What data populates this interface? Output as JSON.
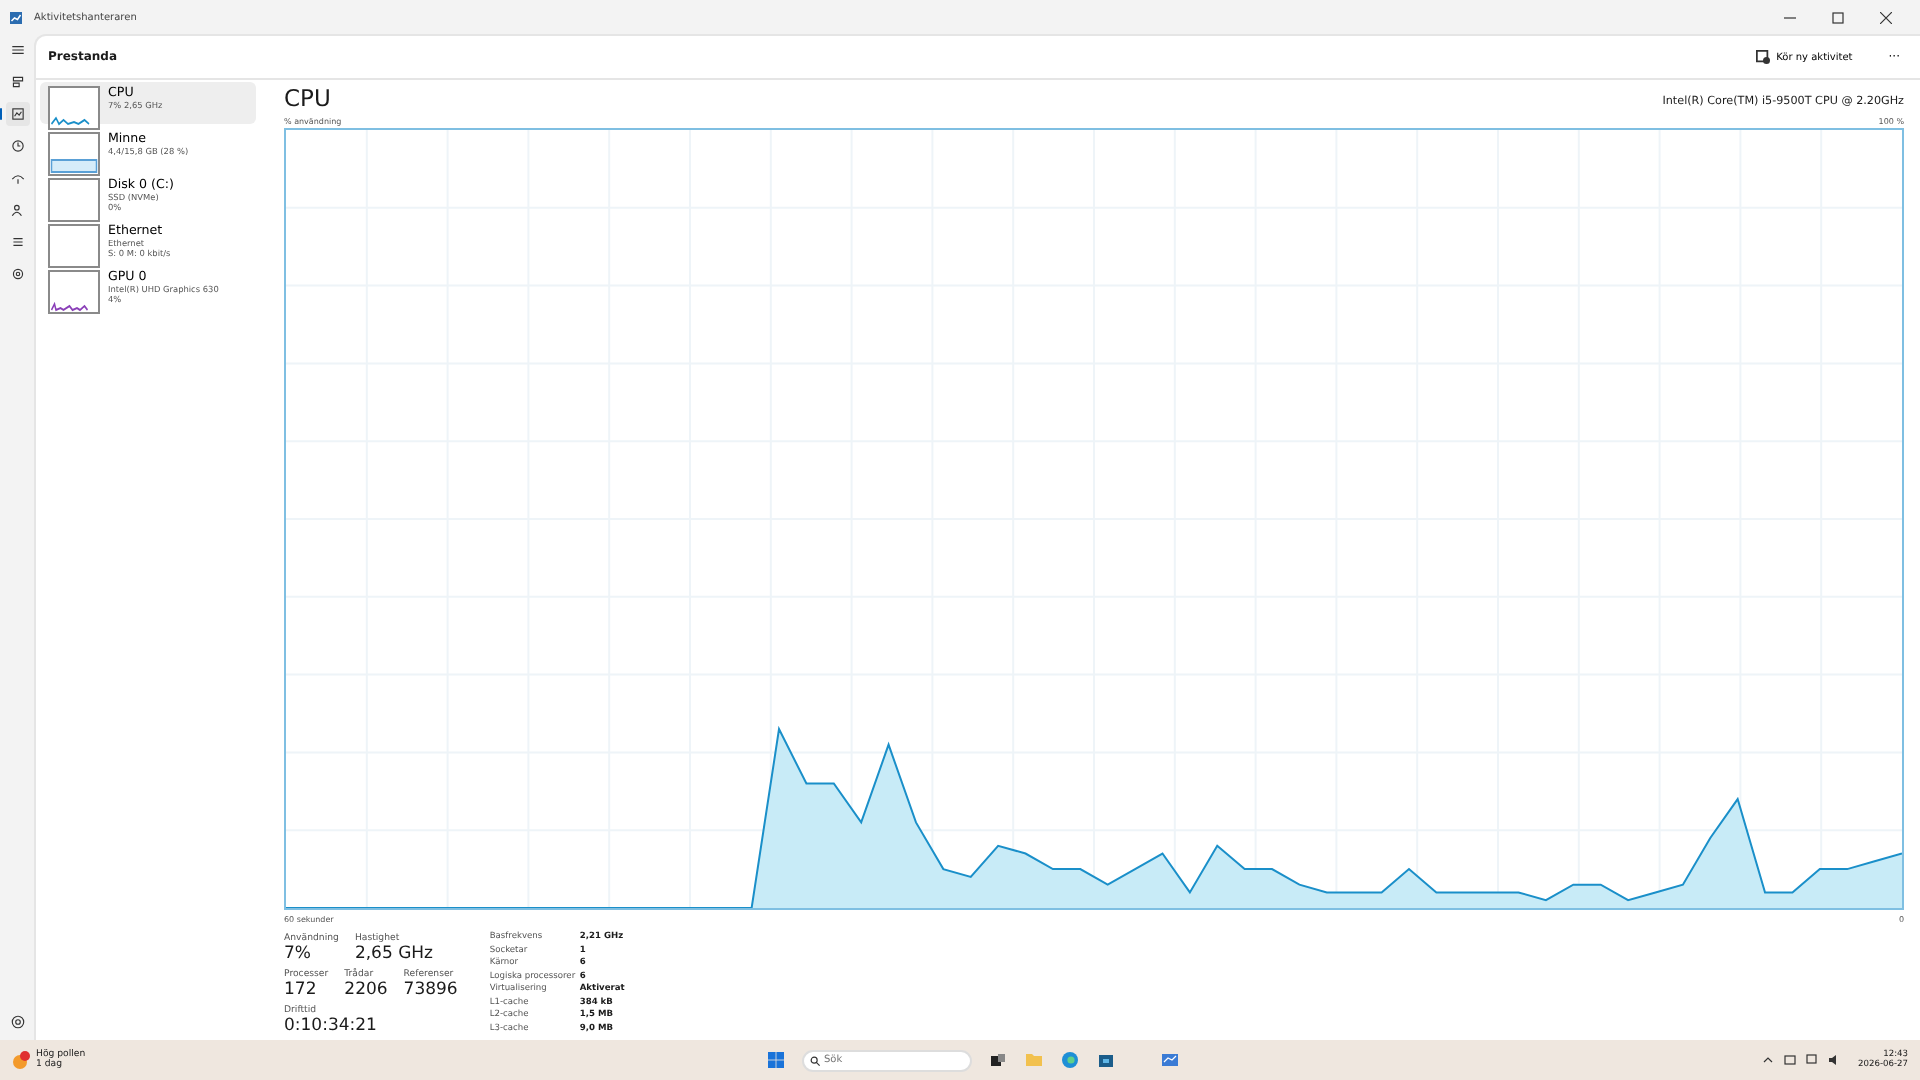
{
  "window": {
    "title": "Aktivitetshanteraren"
  },
  "header": {
    "section": "Prestanda",
    "action": "Kör ny aktivitet",
    "more": "···"
  },
  "nav_rail": [
    {
      "kind": "menu",
      "selected": false
    },
    {
      "kind": "processes",
      "selected": false
    },
    {
      "kind": "performance",
      "selected": true
    },
    {
      "kind": "history",
      "selected": false
    },
    {
      "kind": "startup",
      "selected": false
    },
    {
      "kind": "users",
      "selected": false
    },
    {
      "kind": "details",
      "selected": false
    },
    {
      "kind": "services",
      "selected": false
    }
  ],
  "sidebar": {
    "items": [
      {
        "kind": "cpu",
        "name": "CPU",
        "detail_1": "7% 2,65 GHz",
        "selected": true
      },
      {
        "kind": "memory",
        "name": "Minne",
        "detail_1": "4,4/15,8 GB (28 %)",
        "selected": false
      },
      {
        "kind": "disk",
        "name": "Disk 0 (C:)",
        "detail_1": "SSD (NVMe)",
        "detail_2": "0%",
        "selected": false
      },
      {
        "kind": "disk",
        "name": "Ethernet",
        "detail_1": "Ethernet",
        "detail_2": "S: 0 M: 0 kbit/s",
        "selected": false
      },
      {
        "kind": "gpu",
        "name": "GPU 0",
        "detail_1": "Intel(R) UHD Graphics 630",
        "detail_2": "4%",
        "selected": false
      }
    ]
  },
  "main": {
    "title": "CPU",
    "model": "Intel(R) Core(TM) i5-9500T CPU @ 2.20GHz",
    "y_caption": "% användning",
    "y_max_label": "100 %",
    "x_left_label": "60 sekunder",
    "x_right_label": "0",
    "stats": [
      {
        "label": "Användning",
        "value": "7%"
      },
      {
        "label": "Hastighet",
        "value": "2,65 GHz"
      }
    ],
    "counts": [
      {
        "label": "Processer",
        "value": "172"
      },
      {
        "label": "Trådar",
        "value": "2206"
      },
      {
        "label": "Referenser",
        "value": "73896"
      }
    ],
    "uptime": {
      "label": "Drifttid",
      "value": "0:10:34:21"
    },
    "details": [
      {
        "label": "Basfrekvens",
        "value": "2,21 GHz"
      },
      {
        "label": "Socketar",
        "value": "1"
      },
      {
        "label": "Kärnor",
        "value": "6"
      },
      {
        "label": "Logiska processorer",
        "value": "6"
      },
      {
        "label": "Virtualisering",
        "value": "Aktiverat"
      },
      {
        "label": "L1-cache",
        "value": "384 kB"
      },
      {
        "label": "L2-cache",
        "value": "1,5 MB"
      },
      {
        "label": "L3-cache",
        "value": "9,0 MB"
      }
    ]
  },
  "taskbar": {
    "weather_title": "Hög pollen",
    "weather_sub": "1 dag",
    "search_placeholder": "Sök",
    "time": "12:43",
    "date": "2026-06-27"
  }
}
